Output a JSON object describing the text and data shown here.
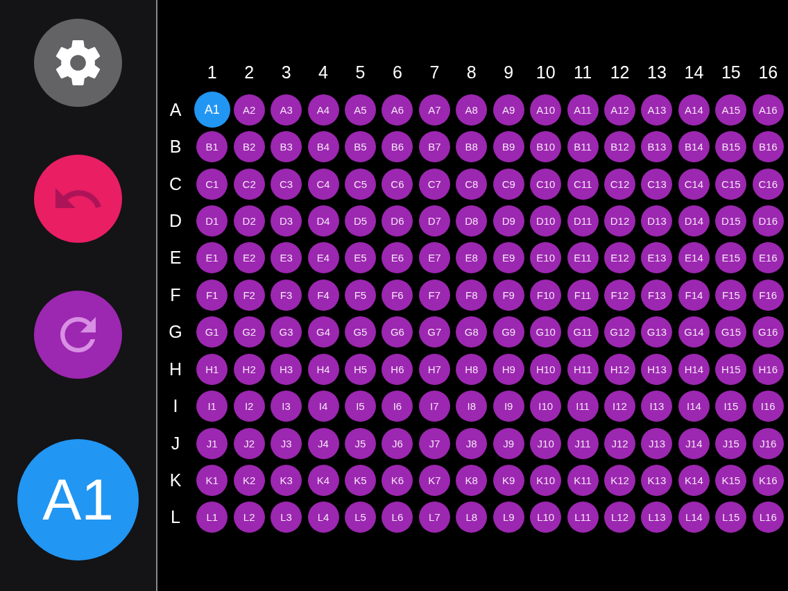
{
  "sidebar": {
    "buttons": [
      {
        "kind": "settings"
      },
      {
        "kind": "undo"
      },
      {
        "kind": "redo"
      }
    ],
    "current_well": "A1"
  },
  "plate": {
    "columns": [
      "1",
      "2",
      "3",
      "4",
      "5",
      "6",
      "7",
      "8",
      "9",
      "10",
      "11",
      "12",
      "13",
      "14",
      "15",
      "16"
    ],
    "rows": [
      {
        "label": "A",
        "wells": [
          {
            "label": "A1",
            "selected": true
          },
          {
            "label": "A2",
            "selected": false
          },
          {
            "label": "A3",
            "selected": false
          },
          {
            "label": "A4",
            "selected": false
          },
          {
            "label": "A5",
            "selected": false
          },
          {
            "label": "A6",
            "selected": false
          },
          {
            "label": "A7",
            "selected": false
          },
          {
            "label": "A8",
            "selected": false
          },
          {
            "label": "A9",
            "selected": false
          },
          {
            "label": "A10",
            "selected": false
          },
          {
            "label": "A11",
            "selected": false
          },
          {
            "label": "A12",
            "selected": false
          },
          {
            "label": "A13",
            "selected": false
          },
          {
            "label": "A14",
            "selected": false
          },
          {
            "label": "A15",
            "selected": false
          },
          {
            "label": "A16",
            "selected": false
          }
        ]
      },
      {
        "label": "B",
        "wells": [
          {
            "label": "B1",
            "selected": false
          },
          {
            "label": "B2",
            "selected": false
          },
          {
            "label": "B3",
            "selected": false
          },
          {
            "label": "B4",
            "selected": false
          },
          {
            "label": "B5",
            "selected": false
          },
          {
            "label": "B6",
            "selected": false
          },
          {
            "label": "B7",
            "selected": false
          },
          {
            "label": "B8",
            "selected": false
          },
          {
            "label": "B9",
            "selected": false
          },
          {
            "label": "B10",
            "selected": false
          },
          {
            "label": "B11",
            "selected": false
          },
          {
            "label": "B12",
            "selected": false
          },
          {
            "label": "B13",
            "selected": false
          },
          {
            "label": "B14",
            "selected": false
          },
          {
            "label": "B15",
            "selected": false
          },
          {
            "label": "B16",
            "selected": false
          }
        ]
      },
      {
        "label": "C",
        "wells": [
          {
            "label": "C1",
            "selected": false
          },
          {
            "label": "C2",
            "selected": false
          },
          {
            "label": "C3",
            "selected": false
          },
          {
            "label": "C4",
            "selected": false
          },
          {
            "label": "C5",
            "selected": false
          },
          {
            "label": "C6",
            "selected": false
          },
          {
            "label": "C7",
            "selected": false
          },
          {
            "label": "C8",
            "selected": false
          },
          {
            "label": "C9",
            "selected": false
          },
          {
            "label": "C10",
            "selected": false
          },
          {
            "label": "C11",
            "selected": false
          },
          {
            "label": "C12",
            "selected": false
          },
          {
            "label": "C13",
            "selected": false
          },
          {
            "label": "C14",
            "selected": false
          },
          {
            "label": "C15",
            "selected": false
          },
          {
            "label": "C16",
            "selected": false
          }
        ]
      },
      {
        "label": "D",
        "wells": [
          {
            "label": "D1",
            "selected": false
          },
          {
            "label": "D2",
            "selected": false
          },
          {
            "label": "D3",
            "selected": false
          },
          {
            "label": "D4",
            "selected": false
          },
          {
            "label": "D5",
            "selected": false
          },
          {
            "label": "D6",
            "selected": false
          },
          {
            "label": "D7",
            "selected": false
          },
          {
            "label": "D8",
            "selected": false
          },
          {
            "label": "D9",
            "selected": false
          },
          {
            "label": "D10",
            "selected": false
          },
          {
            "label": "D11",
            "selected": false
          },
          {
            "label": "D12",
            "selected": false
          },
          {
            "label": "D13",
            "selected": false
          },
          {
            "label": "D14",
            "selected": false
          },
          {
            "label": "D15",
            "selected": false
          },
          {
            "label": "D16",
            "selected": false
          }
        ]
      },
      {
        "label": "E",
        "wells": [
          {
            "label": "E1",
            "selected": false
          },
          {
            "label": "E2",
            "selected": false
          },
          {
            "label": "E3",
            "selected": false
          },
          {
            "label": "E4",
            "selected": false
          },
          {
            "label": "E5",
            "selected": false
          },
          {
            "label": "E6",
            "selected": false
          },
          {
            "label": "E7",
            "selected": false
          },
          {
            "label": "E8",
            "selected": false
          },
          {
            "label": "E9",
            "selected": false
          },
          {
            "label": "E10",
            "selected": false
          },
          {
            "label": "E11",
            "selected": false
          },
          {
            "label": "E12",
            "selected": false
          },
          {
            "label": "E13",
            "selected": false
          },
          {
            "label": "E14",
            "selected": false
          },
          {
            "label": "E15",
            "selected": false
          },
          {
            "label": "E16",
            "selected": false
          }
        ]
      },
      {
        "label": "F",
        "wells": [
          {
            "label": "F1",
            "selected": false
          },
          {
            "label": "F2",
            "selected": false
          },
          {
            "label": "F3",
            "selected": false
          },
          {
            "label": "F4",
            "selected": false
          },
          {
            "label": "F5",
            "selected": false
          },
          {
            "label": "F6",
            "selected": false
          },
          {
            "label": "F7",
            "selected": false
          },
          {
            "label": "F8",
            "selected": false
          },
          {
            "label": "F9",
            "selected": false
          },
          {
            "label": "F10",
            "selected": false
          },
          {
            "label": "F11",
            "selected": false
          },
          {
            "label": "F12",
            "selected": false
          },
          {
            "label": "F13",
            "selected": false
          },
          {
            "label": "F14",
            "selected": false
          },
          {
            "label": "F15",
            "selected": false
          },
          {
            "label": "F16",
            "selected": false
          }
        ]
      },
      {
        "label": "G",
        "wells": [
          {
            "label": "G1",
            "selected": false
          },
          {
            "label": "G2",
            "selected": false
          },
          {
            "label": "G3",
            "selected": false
          },
          {
            "label": "G4",
            "selected": false
          },
          {
            "label": "G5",
            "selected": false
          },
          {
            "label": "G6",
            "selected": false
          },
          {
            "label": "G7",
            "selected": false
          },
          {
            "label": "G8",
            "selected": false
          },
          {
            "label": "G9",
            "selected": false
          },
          {
            "label": "G10",
            "selected": false
          },
          {
            "label": "G11",
            "selected": false
          },
          {
            "label": "G12",
            "selected": false
          },
          {
            "label": "G13",
            "selected": false
          },
          {
            "label": "G14",
            "selected": false
          },
          {
            "label": "G15",
            "selected": false
          },
          {
            "label": "G16",
            "selected": false
          }
        ]
      },
      {
        "label": "H",
        "wells": [
          {
            "label": "H1",
            "selected": false
          },
          {
            "label": "H2",
            "selected": false
          },
          {
            "label": "H3",
            "selected": false
          },
          {
            "label": "H4",
            "selected": false
          },
          {
            "label": "H5",
            "selected": false
          },
          {
            "label": "H6",
            "selected": false
          },
          {
            "label": "H7",
            "selected": false
          },
          {
            "label": "H8",
            "selected": false
          },
          {
            "label": "H9",
            "selected": false
          },
          {
            "label": "H10",
            "selected": false
          },
          {
            "label": "H11",
            "selected": false
          },
          {
            "label": "H12",
            "selected": false
          },
          {
            "label": "H13",
            "selected": false
          },
          {
            "label": "H14",
            "selected": false
          },
          {
            "label": "H15",
            "selected": false
          },
          {
            "label": "H16",
            "selected": false
          }
        ]
      },
      {
        "label": "I",
        "wells": [
          {
            "label": "I1",
            "selected": false
          },
          {
            "label": "I2",
            "selected": false
          },
          {
            "label": "I3",
            "selected": false
          },
          {
            "label": "I4",
            "selected": false
          },
          {
            "label": "I5",
            "selected": false
          },
          {
            "label": "I6",
            "selected": false
          },
          {
            "label": "I7",
            "selected": false
          },
          {
            "label": "I8",
            "selected": false
          },
          {
            "label": "I9",
            "selected": false
          },
          {
            "label": "I10",
            "selected": false
          },
          {
            "label": "I11",
            "selected": false
          },
          {
            "label": "I12",
            "selected": false
          },
          {
            "label": "I13",
            "selected": false
          },
          {
            "label": "I14",
            "selected": false
          },
          {
            "label": "I15",
            "selected": false
          },
          {
            "label": "I16",
            "selected": false
          }
        ]
      },
      {
        "label": "J",
        "wells": [
          {
            "label": "J1",
            "selected": false
          },
          {
            "label": "J2",
            "selected": false
          },
          {
            "label": "J3",
            "selected": false
          },
          {
            "label": "J4",
            "selected": false
          },
          {
            "label": "J5",
            "selected": false
          },
          {
            "label": "J6",
            "selected": false
          },
          {
            "label": "J7",
            "selected": false
          },
          {
            "label": "J8",
            "selected": false
          },
          {
            "label": "J9",
            "selected": false
          },
          {
            "label": "J10",
            "selected": false
          },
          {
            "label": "J11",
            "selected": false
          },
          {
            "label": "J12",
            "selected": false
          },
          {
            "label": "J13",
            "selected": false
          },
          {
            "label": "J14",
            "selected": false
          },
          {
            "label": "J15",
            "selected": false
          },
          {
            "label": "J16",
            "selected": false
          }
        ]
      },
      {
        "label": "K",
        "wells": [
          {
            "label": "K1",
            "selected": false
          },
          {
            "label": "K2",
            "selected": false
          },
          {
            "label": "K3",
            "selected": false
          },
          {
            "label": "K4",
            "selected": false
          },
          {
            "label": "K5",
            "selected": false
          },
          {
            "label": "K6",
            "selected": false
          },
          {
            "label": "K7",
            "selected": false
          },
          {
            "label": "K8",
            "selected": false
          },
          {
            "label": "K9",
            "selected": false
          },
          {
            "label": "K10",
            "selected": false
          },
          {
            "label": "K11",
            "selected": false
          },
          {
            "label": "K12",
            "selected": false
          },
          {
            "label": "K13",
            "selected": false
          },
          {
            "label": "K14",
            "selected": false
          },
          {
            "label": "K15",
            "selected": false
          },
          {
            "label": "K16",
            "selected": false
          }
        ]
      },
      {
        "label": "L",
        "wells": [
          {
            "label": "L1",
            "selected": false
          },
          {
            "label": "L2",
            "selected": false
          },
          {
            "label": "L3",
            "selected": false
          },
          {
            "label": "L4",
            "selected": false
          },
          {
            "label": "L5",
            "selected": false
          },
          {
            "label": "L6",
            "selected": false
          },
          {
            "label": "L7",
            "selected": false
          },
          {
            "label": "L8",
            "selected": false
          },
          {
            "label": "L9",
            "selected": false
          },
          {
            "label": "L10",
            "selected": false
          },
          {
            "label": "L11",
            "selected": false
          },
          {
            "label": "L12",
            "selected": false
          },
          {
            "label": "L13",
            "selected": false
          },
          {
            "label": "L14",
            "selected": false
          },
          {
            "label": "L15",
            "selected": false
          },
          {
            "label": "L16",
            "selected": false
          }
        ]
      }
    ]
  }
}
